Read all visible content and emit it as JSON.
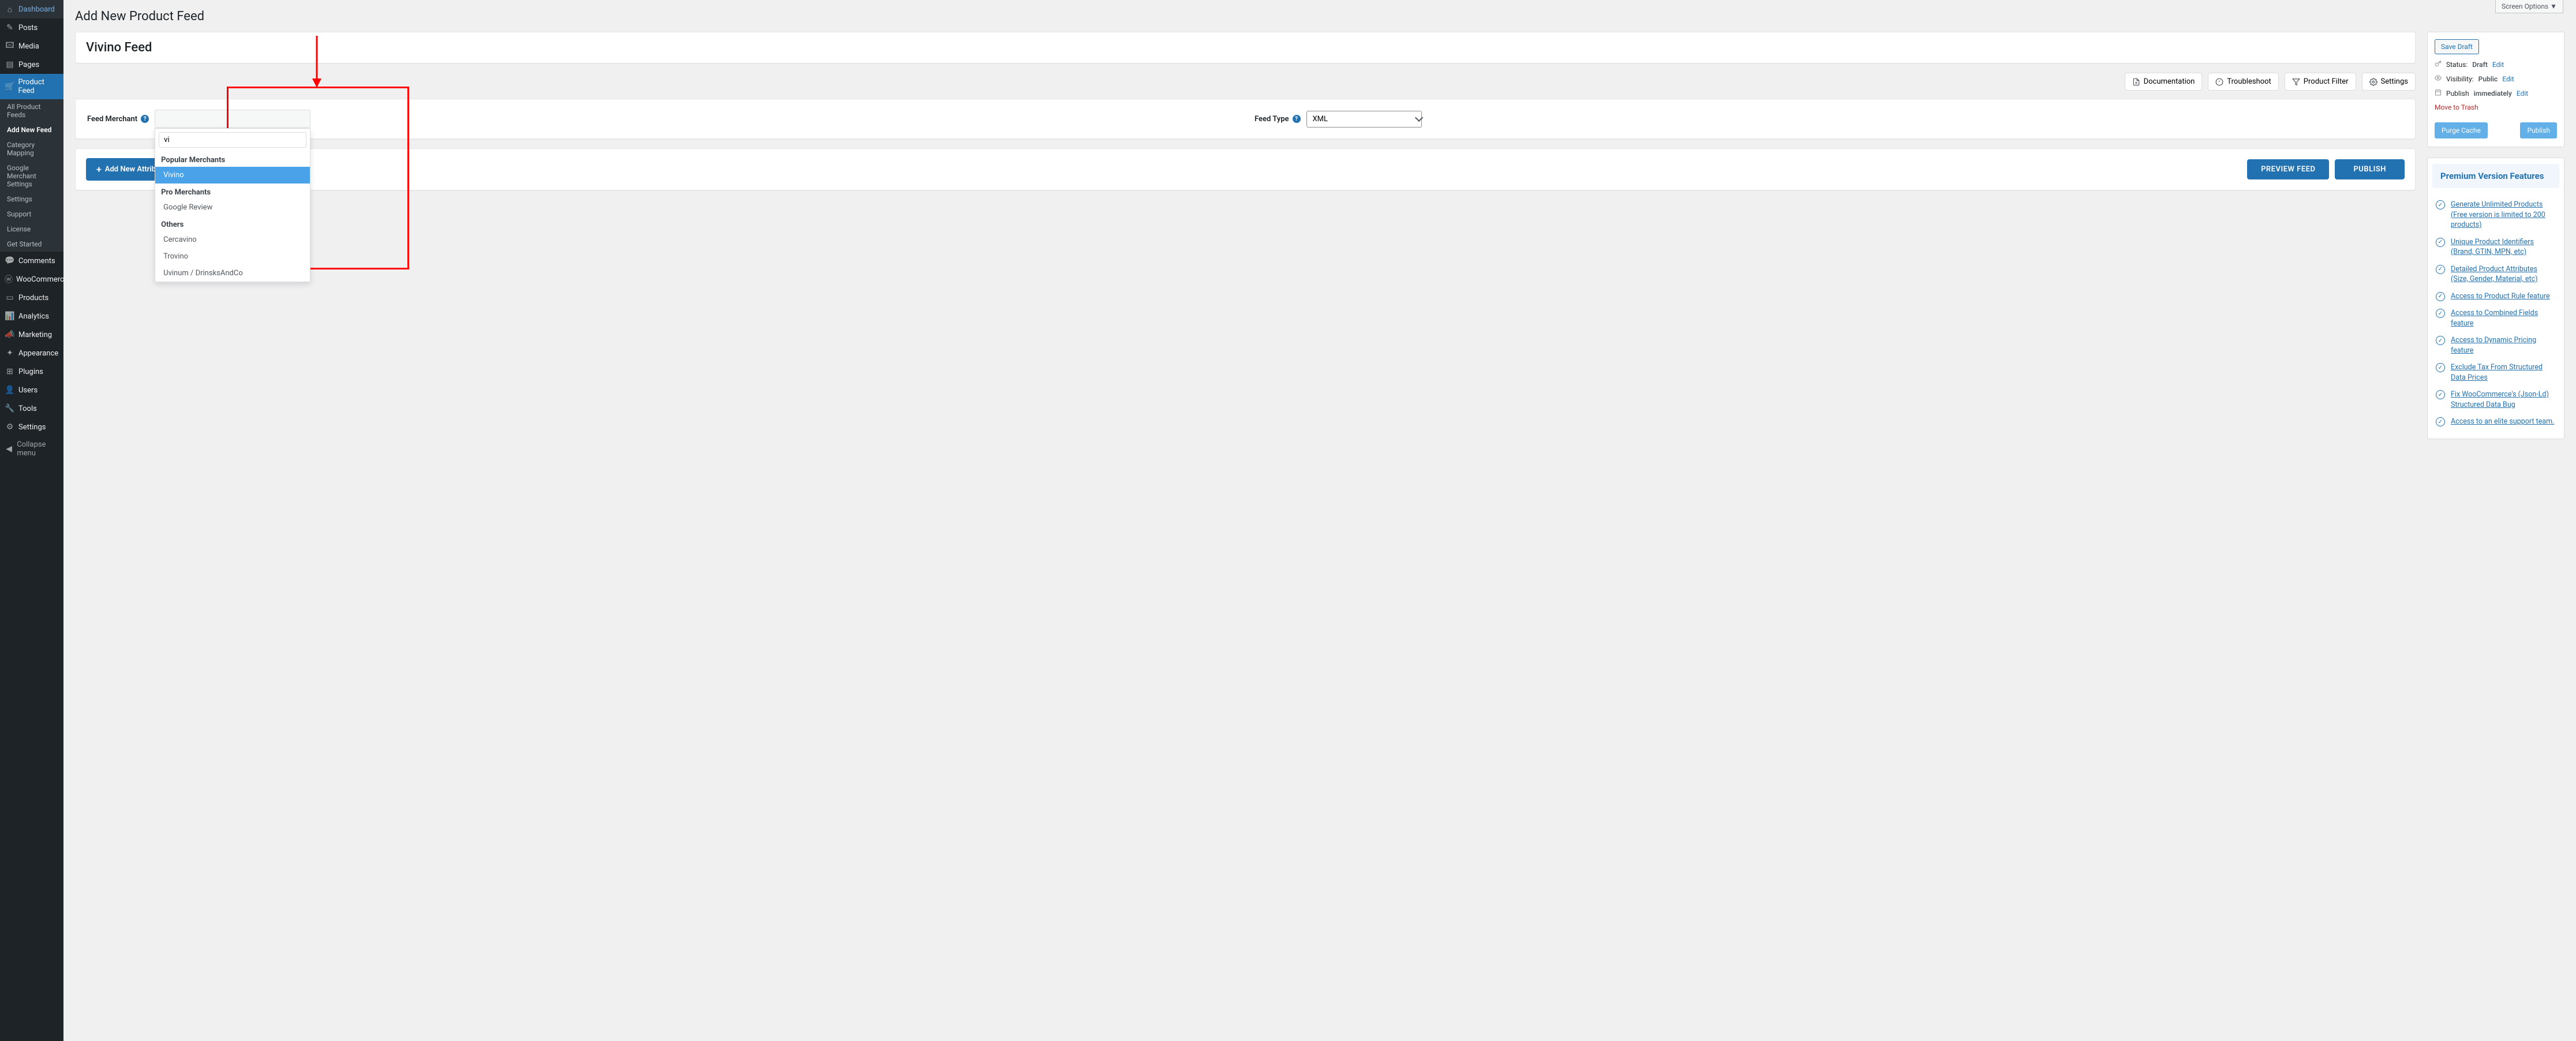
{
  "screen_options": "Screen Options ▼",
  "page_title": "Add New Product Feed",
  "feed_title": "Vivino Feed",
  "sidebar": [
    {
      "icon": "⌂",
      "label": "Dashboard"
    },
    {
      "icon": "✎",
      "label": "Posts"
    },
    {
      "icon": "🖾",
      "label": "Media"
    },
    {
      "icon": "▤",
      "label": "Pages"
    },
    {
      "icon": "🛒",
      "label": "Product Feed",
      "active": true
    },
    {
      "icon": "💬",
      "label": "Comments"
    },
    {
      "icon": "ⓦ",
      "label": "WooCommerce"
    },
    {
      "icon": "▭",
      "label": "Products"
    },
    {
      "icon": "📊",
      "label": "Analytics"
    },
    {
      "icon": "📣",
      "label": "Marketing"
    },
    {
      "icon": "✦",
      "label": "Appearance"
    },
    {
      "icon": "⊞",
      "label": "Plugins"
    },
    {
      "icon": "👤",
      "label": "Users"
    },
    {
      "icon": "🔧",
      "label": "Tools"
    },
    {
      "icon": "⚙",
      "label": "Settings"
    },
    {
      "icon": "◀",
      "label": "Collapse menu",
      "collapse": true
    }
  ],
  "submenu": [
    {
      "label": "All Product Feeds"
    },
    {
      "label": "Add New Feed",
      "current": true
    },
    {
      "label": "Category Mapping"
    },
    {
      "label": "Google Merchant Settings"
    },
    {
      "label": "Settings"
    },
    {
      "label": "Support"
    },
    {
      "label": "License"
    },
    {
      "label": "Get Started"
    }
  ],
  "toolbar": {
    "documentation": "Documentation",
    "troubleshoot": "Troubleshoot",
    "product_filter": "Product Filter",
    "settings": "Settings"
  },
  "form": {
    "merchant_label": "Feed Merchant",
    "type_label": "Feed Type",
    "type_value": "XML",
    "search_value": "vi"
  },
  "dropdown": {
    "groups": [
      {
        "label": "Popular Merchants",
        "options": [
          {
            "label": "Vivino",
            "highlighted": true
          }
        ]
      },
      {
        "label": "Pro Merchants",
        "options": [
          {
            "label": "Google Review"
          }
        ]
      },
      {
        "label": "Others",
        "options": [
          {
            "label": "Cercavino"
          },
          {
            "label": "Trovino"
          },
          {
            "label": "Uvinum / DrinsksAndCo"
          }
        ]
      }
    ]
  },
  "actions": {
    "add_attr": "Add New Attribute",
    "preview": "PREVIEW FEED",
    "publish": "PUBLISH"
  },
  "publish_box": {
    "save_draft": "Save Draft",
    "status_label": "Status:",
    "status_value": "Draft",
    "visibility_label": "Visibility:",
    "visibility_value": "Public",
    "publish_label": "Publish",
    "publish_value": "immediately",
    "edit": "Edit",
    "trash": "Move to Trash",
    "purge": "Purge Cache",
    "publish_btn": "Publish"
  },
  "premium": {
    "title": "Premium Version Features",
    "features": [
      "Generate Unlimited Products (Free version is limited to 200 products)",
      "Unique Product Identifiers (Brand, GTIN, MPN, etc)",
      "Detailed Product Attributes (Size, Gender, Material, etc)",
      "Access to Product Rule feature",
      "Access to Combined Fields feature",
      "Access to Dynamic Pricing feature",
      "Exclude Tax From Structured Data Prices",
      "Fix WooCommerce's (Json-Ld) Structured Data Bug",
      "Access to an elite support team."
    ]
  }
}
